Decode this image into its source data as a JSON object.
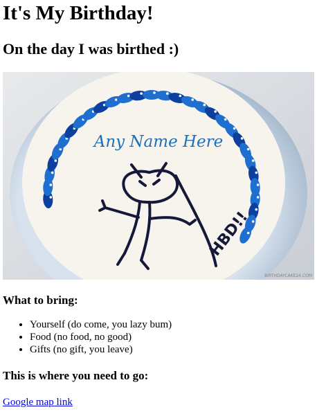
{
  "heading": "It's My Birthday!",
  "subheading": "On the day I was birthed :)",
  "cake_image": {
    "cake_text": "Any Name Here",
    "side_text": "HBD!!",
    "watermark": "BIRTHDAYCAKE24.COM",
    "colors": {
      "icing": "#f7f5ee",
      "petals": "#1f6fd0",
      "petals_dark": "#0c3f9e",
      "line": "#16183a"
    }
  },
  "bring_heading": "What to bring:",
  "bring_items": [
    "Yourself (do come, you lazy bum)",
    "Food (no food, no good)",
    "Gifts (no gift, you leave)"
  ],
  "go_heading": "This is where you need to go:",
  "map_link": "Google map link"
}
